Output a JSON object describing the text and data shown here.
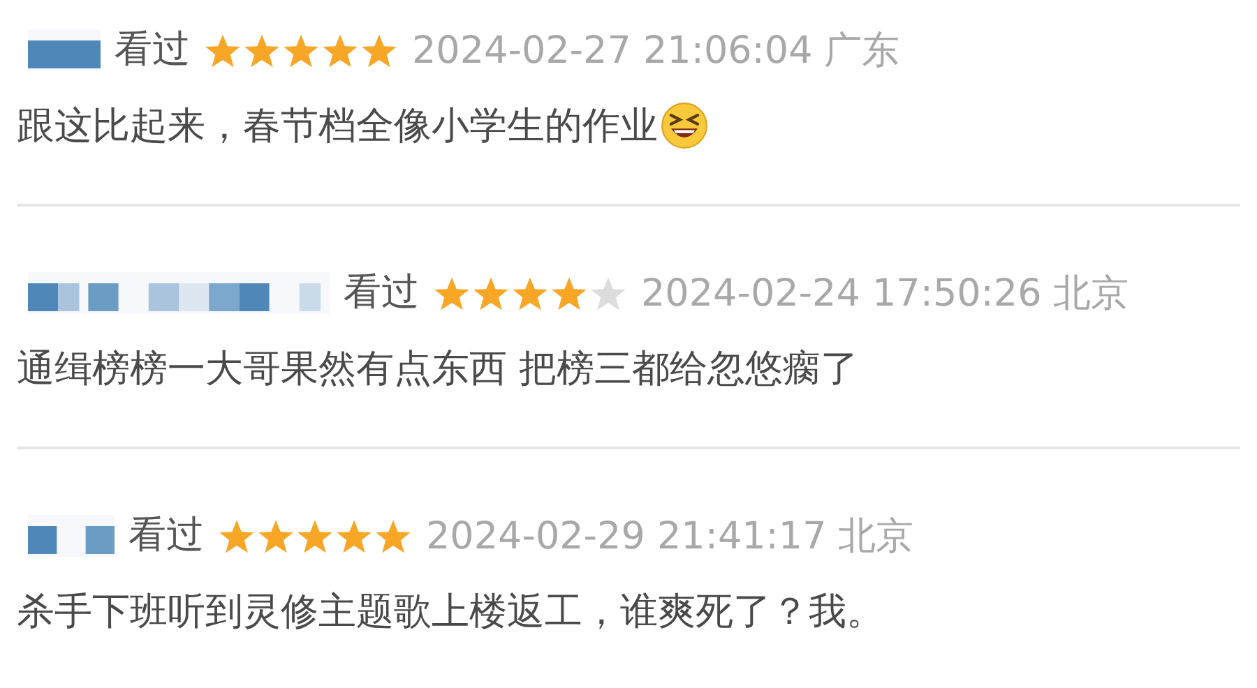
{
  "comments": [
    {
      "status": "看过",
      "stars": 5,
      "time": "2024-02-27 21:06:04",
      "location": "广东",
      "text": "跟这比起来，春节档全像小学生的作业",
      "emoji": {
        "kind": "laugh"
      }
    },
    {
      "status": "看过",
      "stars": 4,
      "time": "2024-02-24 17:50:26",
      "location": "北京",
      "text": "通缉榜榜一大哥果然有点东西 把榜三都给忽悠瘸了"
    },
    {
      "status": "看过",
      "stars": 5,
      "time": "2024-02-29 21:41:17",
      "location": "北京",
      "text": "杀手下班听到灵修主题歌上楼返工，谁爽死了？我。"
    }
  ]
}
